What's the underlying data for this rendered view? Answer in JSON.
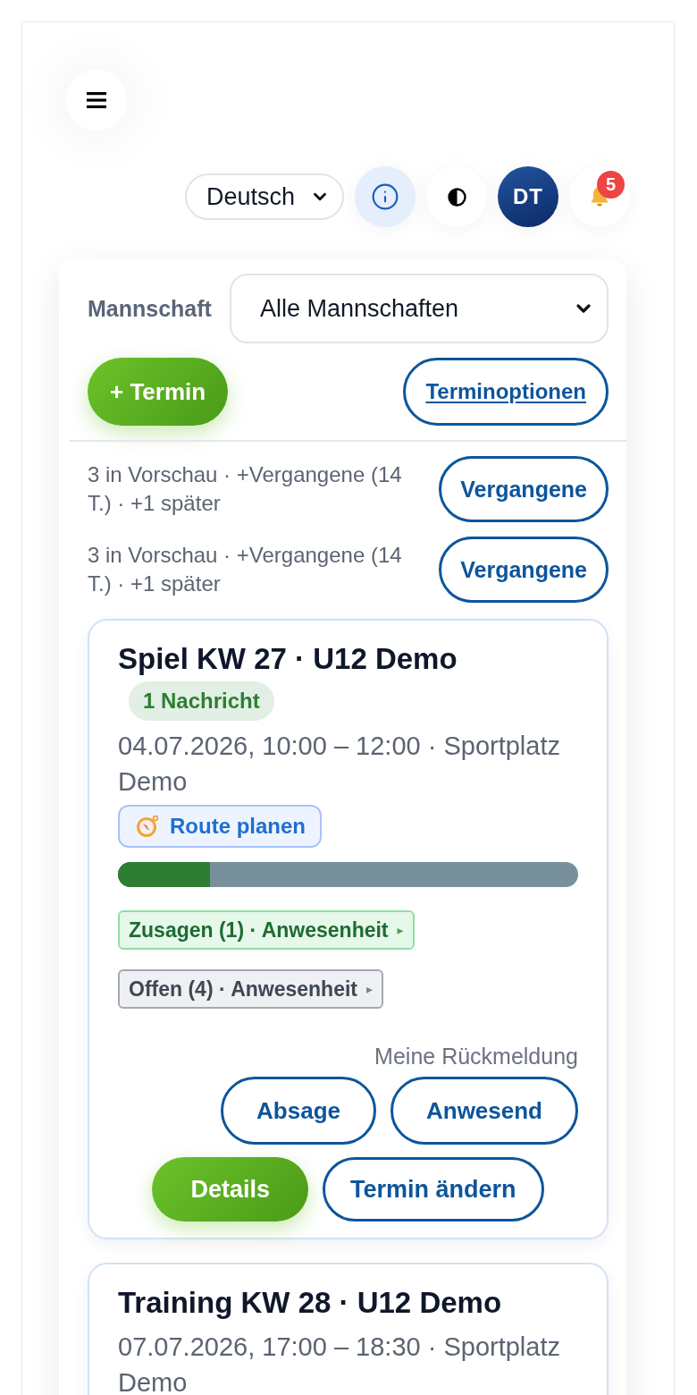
{
  "toolbar": {
    "language_select": {
      "value": "Deutsch"
    },
    "avatar": {
      "initials": "DT"
    },
    "notifications": {
      "count": "5"
    }
  },
  "filter": {
    "label": "Mannschaft",
    "team_select": {
      "value": "Alle Mannschaften"
    }
  },
  "actions": {
    "add_button": "+ Termin",
    "options_link": "Terminoptionen"
  },
  "summaries": [
    {
      "text": "3 in Vorschau · +Vergangene (14 T.) · +1 später",
      "button": "Vergangene"
    },
    {
      "text": "3 in Vorschau · +Vergangene (14 T.) · +1 später",
      "button": "Vergangene"
    }
  ],
  "events": [
    {
      "title": "Spiel KW 27 · U12 Demo",
      "badge": "1 Nachricht",
      "when": "04.07.2026, 10:00 – 12:00 · Sportplatz Demo",
      "route_button": "Route planen",
      "attendance": {
        "level": 0.2
      },
      "chips": [
        {
          "kind": "confirmed",
          "label": "Zusagen (1) · Anwesenheit",
          "arrow": "▸"
        },
        {
          "kind": "open",
          "label": "Offen (4) · Anwesenheit",
          "arrow": "▸"
        }
      ],
      "response": {
        "label": "Meine Rückmeldung",
        "buttons": [
          "Absage",
          "Anwesend"
        ]
      },
      "buttons": [
        {
          "kind": "primary",
          "label": "Details"
        },
        {
          "kind": "outline",
          "label": "Termin ändern"
        }
      ]
    },
    {
      "title": "Training KW 28 · U12 Demo",
      "when": "07.07.2026, 17:00 – 18:30 · Sportplatz Demo"
    }
  ]
}
